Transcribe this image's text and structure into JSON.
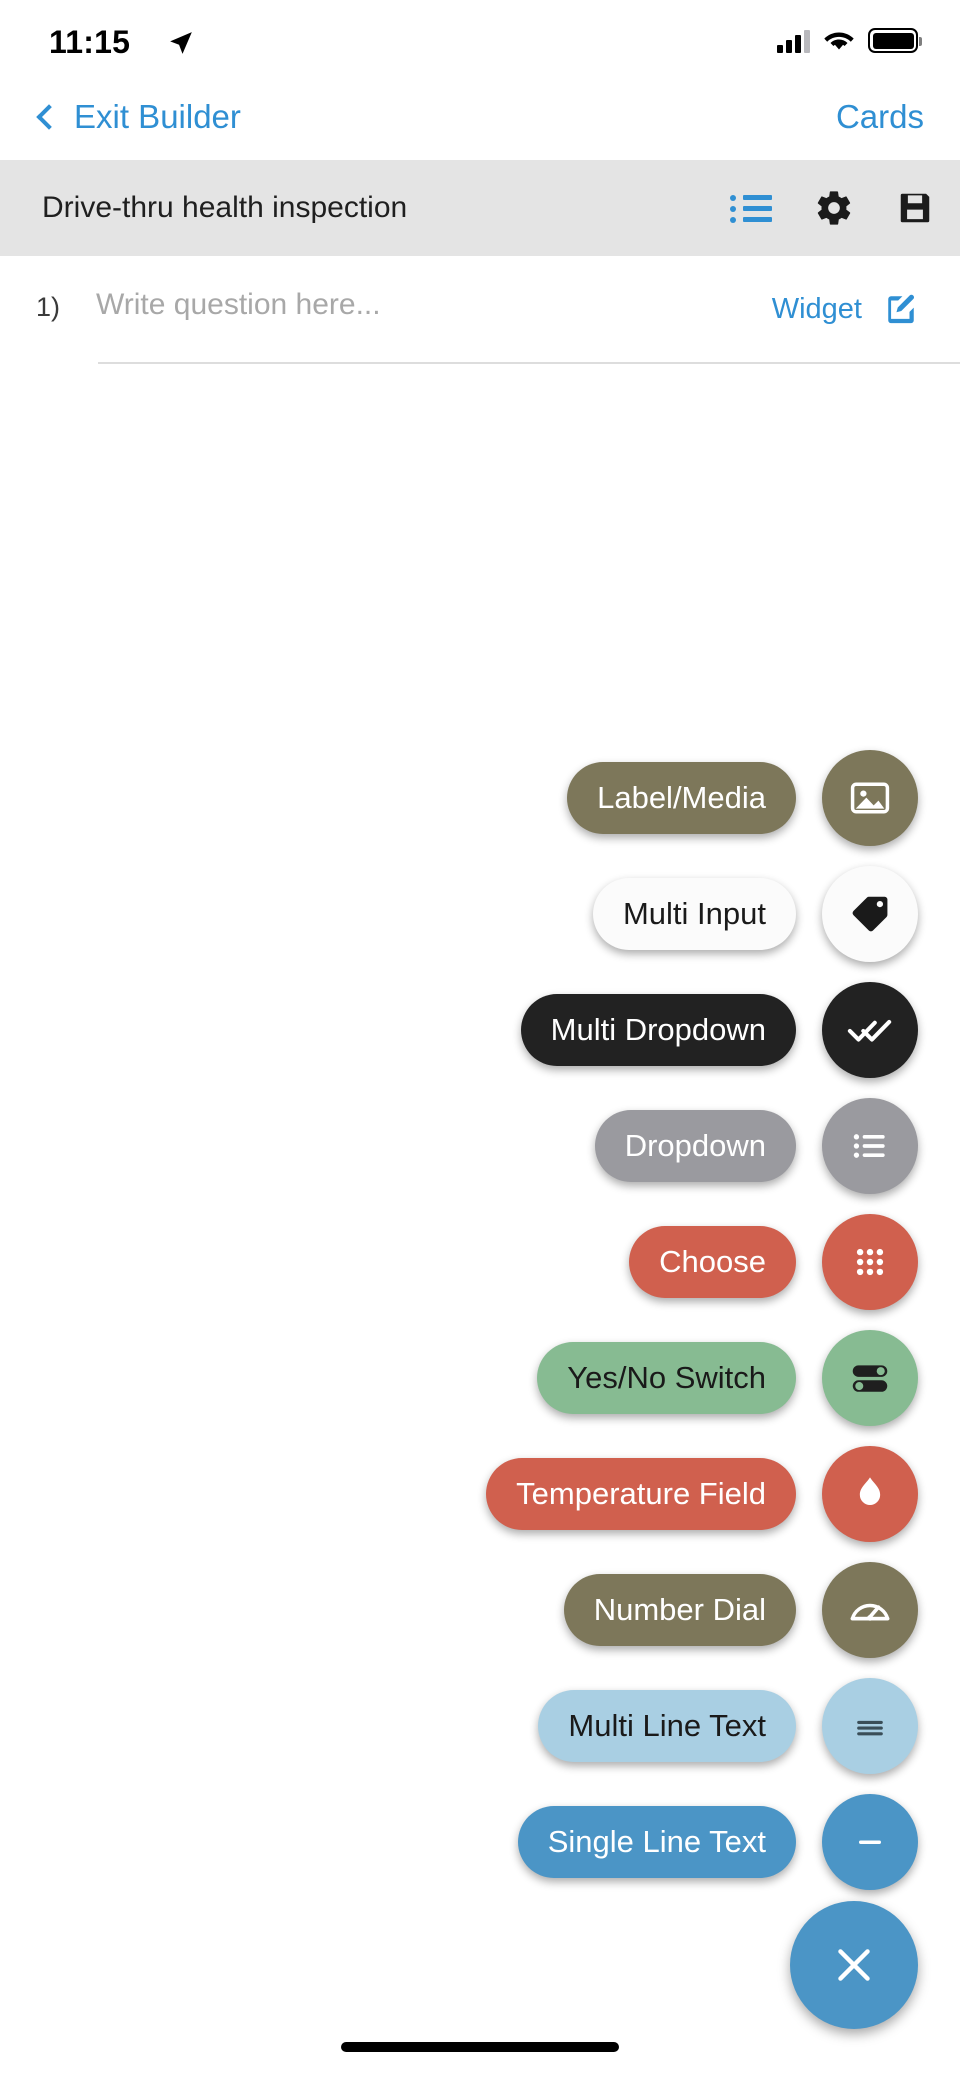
{
  "status_bar": {
    "time": "11:15",
    "location_icon": "location-arrow-icon",
    "cellular_icon": "cellular-signal-icon",
    "wifi_icon": "wifi-icon",
    "battery_icon": "battery-icon"
  },
  "nav_bar": {
    "back_label": "Exit Builder",
    "right_label": "Cards"
  },
  "title_bar": {
    "title": "Drive-thru health inspection",
    "tools": [
      {
        "name": "list-view-icon"
      },
      {
        "name": "gear-icon"
      },
      {
        "name": "save-icon"
      }
    ]
  },
  "question": {
    "number": "1)",
    "placeholder": "Write question here...",
    "widget_label": "Widget",
    "edit_icon": "pencil-square-icon"
  },
  "speed_dial": {
    "items": [
      {
        "label": "Label/Media",
        "icon": "image-icon",
        "pill_bg": "#7d775a",
        "pill_text": "#ffffff",
        "circle_bg": "#7d775a",
        "icon_color": "#ffffff"
      },
      {
        "label": "Multi Input",
        "icon": "tag-icon",
        "pill_bg": "#fbfbfb",
        "pill_text": "#1a1a1a",
        "circle_bg": "#fbfbfb",
        "icon_color": "#1a1a1a"
      },
      {
        "label": "Multi Dropdown",
        "icon": "double-check-icon",
        "pill_bg": "#222222",
        "pill_text": "#ffffff",
        "circle_bg": "#222222",
        "icon_color": "#ffffff"
      },
      {
        "label": "Dropdown",
        "icon": "bullet-list-icon",
        "pill_bg": "#9a9a9f",
        "pill_text": "#ffffff",
        "circle_bg": "#9a9a9f",
        "icon_color": "#ffffff"
      },
      {
        "label": "Choose",
        "icon": "grid-dots-icon",
        "pill_bg": "#d0604e",
        "pill_text": "#ffffff",
        "circle_bg": "#d0604e",
        "icon_color": "#ffffff"
      },
      {
        "label": "Yes/No Switch",
        "icon": "toggle-switch-icon",
        "pill_bg": "#87bb92",
        "pill_text": "#1a1a1a",
        "circle_bg": "#87bb92",
        "icon_color": "#1f1f1f"
      },
      {
        "label": "Temperature Field",
        "icon": "flame-icon",
        "pill_bg": "#d0604e",
        "pill_text": "#ffffff",
        "circle_bg": "#d0604e",
        "icon_color": "#ffffff"
      },
      {
        "label": "Number Dial",
        "icon": "gauge-icon",
        "pill_bg": "#7d775a",
        "pill_text": "#ffffff",
        "circle_bg": "#7d775a",
        "icon_color": "#ffffff"
      },
      {
        "label": "Multi Line Text",
        "icon": "text-lines-icon",
        "pill_bg": "#a9cfe3",
        "pill_text": "#1a1a1a",
        "circle_bg": "#a9cfe3",
        "icon_color": "#3a4e58"
      },
      {
        "label": "Single Line Text",
        "icon": "minus-line-icon",
        "pill_bg": "#4b95c6",
        "pill_text": "#ffffff",
        "circle_bg": "#4b95c6",
        "icon_color": "#ffffff"
      }
    ],
    "close": {
      "icon": "close-x-icon",
      "bg": "#4b95c6",
      "icon_color": "#ffffff"
    }
  },
  "colors": {
    "accent_blue": "#2f8fd3",
    "titlebar_bg": "#e4e4e4"
  }
}
